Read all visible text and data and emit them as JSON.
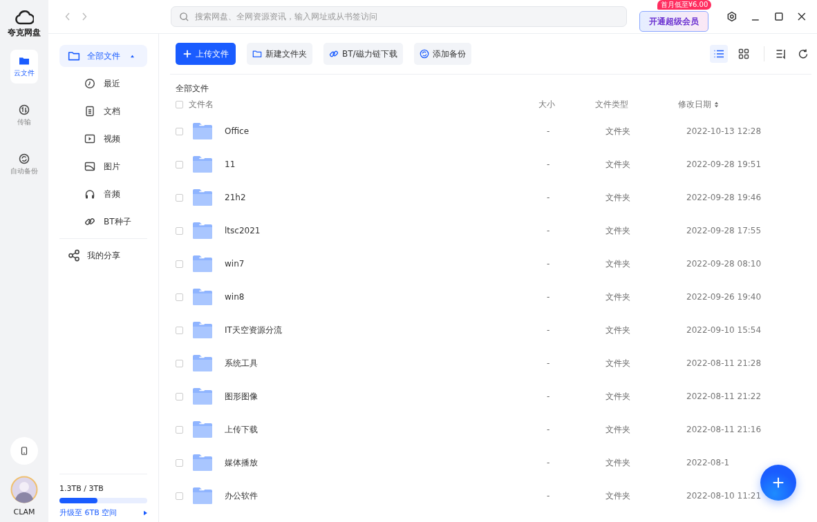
{
  "app": {
    "name": "夸克网盘"
  },
  "rail": [
    {
      "label": "云文件",
      "selected": true
    },
    {
      "label": "传输",
      "selected": false
    },
    {
      "label": "自动备份",
      "selected": false
    }
  ],
  "user": {
    "name": "CLAM"
  },
  "search": {
    "placeholder": "搜索网盘、全网资源资讯，输入网址或从书签访问"
  },
  "vip": {
    "label": "开通超级会员",
    "badge": "首月低至¥6.00"
  },
  "sidebar": {
    "items": [
      {
        "label": "全部文件",
        "selected": true,
        "expanded": true,
        "children": [
          {
            "label": "最近",
            "selected": false
          },
          {
            "label": "文档",
            "selected": false
          },
          {
            "label": "视频",
            "selected": false
          },
          {
            "label": "图片",
            "selected": false
          },
          {
            "label": "音频",
            "selected": false
          },
          {
            "label": "BT种子",
            "selected": false
          }
        ]
      },
      {
        "label": "我的分享",
        "selected": false
      }
    ],
    "storage": {
      "reading": "1.3TB / 3TB",
      "level": 0.43,
      "upgrade": "升级至 6TB 空间"
    }
  },
  "toolbar": [
    {
      "label": "上传文件",
      "kind": "primary"
    },
    {
      "label": "新建文件夹",
      "kind": "secondary"
    },
    {
      "label": "BT/磁力链下载",
      "kind": "secondary"
    },
    {
      "label": "添加备份",
      "kind": "secondary"
    }
  ],
  "view_buttons": [
    {
      "selected": true
    },
    {
      "selected": false
    }
  ],
  "breadcrumb": "全部文件",
  "table": {
    "select_all_checked": false,
    "columns": [
      "文件名",
      "大小",
      "文件类型",
      "修改日期"
    ],
    "rows": [
      {
        "name": "Office",
        "size": "-",
        "type": "文件夹",
        "date": "2022-10-13 12:28",
        "checked": false
      },
      {
        "name": "11",
        "size": "-",
        "type": "文件夹",
        "date": "2022-09-28 19:51",
        "checked": false
      },
      {
        "name": "21h2",
        "size": "-",
        "type": "文件夹",
        "date": "2022-09-28 19:46",
        "checked": false
      },
      {
        "name": "ltsc2021",
        "size": "-",
        "type": "文件夹",
        "date": "2022-09-28 17:55",
        "checked": false
      },
      {
        "name": "win7",
        "size": "-",
        "type": "文件夹",
        "date": "2022-09-28 08:10",
        "checked": false
      },
      {
        "name": "win8",
        "size": "-",
        "type": "文件夹",
        "date": "2022-09-26 19:40",
        "checked": false
      },
      {
        "name": "IT天空资源分流",
        "size": "-",
        "type": "文件夹",
        "date": "2022-09-10 15:54",
        "checked": false
      },
      {
        "name": "系统工具",
        "size": "-",
        "type": "文件夹",
        "date": "2022-08-11 21:28",
        "checked": false
      },
      {
        "name": "图形图像",
        "size": "-",
        "type": "文件夹",
        "date": "2022-08-11 21:22",
        "checked": false
      },
      {
        "name": "上传下载",
        "size": "-",
        "type": "文件夹",
        "date": "2022-08-11 21:16",
        "checked": false
      },
      {
        "name": "媒体播放",
        "size": "-",
        "type": "文件夹",
        "date": "2022-08-1",
        "checked": false
      },
      {
        "name": "办公软件",
        "size": "-",
        "type": "文件夹",
        "date": "2022-08-10 11:21",
        "checked": false
      }
    ]
  }
}
